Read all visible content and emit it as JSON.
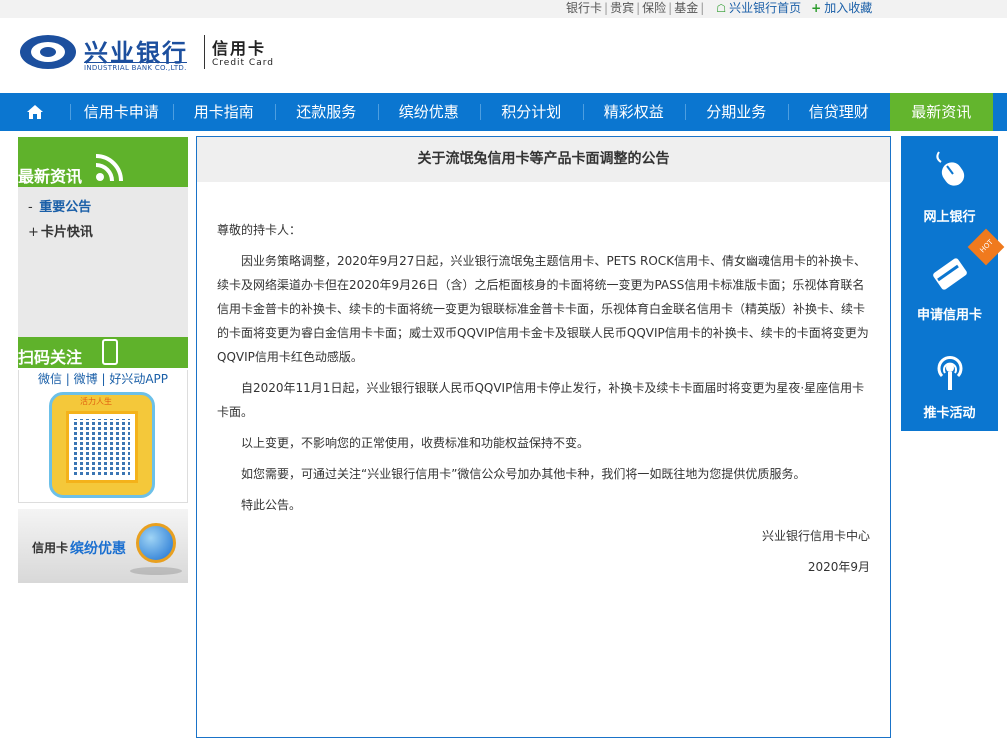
{
  "top_links": {
    "items": [
      "银行卡",
      "贵宾",
      "保险",
      "基金"
    ],
    "home": "兴业银行首页",
    "favorite": "加入收藏"
  },
  "logo": {
    "cn": "兴业银行",
    "en": "INDUSTRIAL BANK CO.,LTD.",
    "card_cn": "信用卡",
    "card_en": "Credit Card"
  },
  "nav": {
    "home_icon": "home-icon",
    "items": [
      "信用卡申请",
      "用卡指南",
      "还款服务",
      "缤纷优惠",
      "积分计划",
      "精彩权益",
      "分期业务",
      "信贷理财",
      "最新资讯"
    ],
    "active_index": 8,
    "bar_color": "#0b76d0",
    "active_color": "#63b52d"
  },
  "sidebar": {
    "news_title": "最新资讯",
    "menu": [
      {
        "marker": "-",
        "label": "重要公告"
      },
      {
        "marker": "+",
        "label": "卡片快讯"
      }
    ],
    "qr_title": "扫码关注",
    "qr_links": "微信 | 微博 | 好兴动APP",
    "qr_badge": "活力人生",
    "promo_prefix": "信用卡",
    "promo_highlight": "缤纷优惠"
  },
  "article": {
    "title": "关于流氓兔信用卡等产品卡面调整的公告",
    "greeting": "尊敬的持卡人：",
    "paragraphs": [
      "因业务策略调整，2020年9月27日起，兴业银行流氓兔主题信用卡、PETS ROCK信用卡、倩女幽魂信用卡的补换卡、续卡及网络渠道办卡但在2020年9月26日（含）之后柜面核身的卡面将统一变更为PASS信用卡标准版卡面；乐视体育联名信用卡金普卡的补换卡、续卡的卡面将统一变更为银联标准金普卡卡面，乐视体育白金联名信用卡（精英版）补换卡、续卡的卡面将变更为睿白金信用卡卡面；威士双币QQVIP信用卡金卡及银联人民币QQVIP信用卡的补换卡、续卡的卡面将变更为QQVIP信用卡红色动感版。",
      "自2020年11月1日起，兴业银行银联人民币QQVIP信用卡停止发行，补换卡及续卡卡面届时将变更为星夜·星座信用卡卡面。",
      "以上变更，不影响您的正常使用，收费标准和功能权益保持不变。",
      "如您需要，可通过关注“兴业银行信用卡”微信公众号加办其他卡种，我们将一如既往地为您提供优质服务。",
      "特此公告。"
    ],
    "signature": "兴业银行信用卡中心",
    "date": "2020年9月"
  },
  "right_bar": {
    "items": [
      {
        "label": "网上银行",
        "icon": "mouse-icon"
      },
      {
        "label": "申请信用卡",
        "icon": "credit-card-icon"
      },
      {
        "label": "推卡活动",
        "icon": "broadcast-icon"
      }
    ],
    "hot_badge": "HOT"
  }
}
